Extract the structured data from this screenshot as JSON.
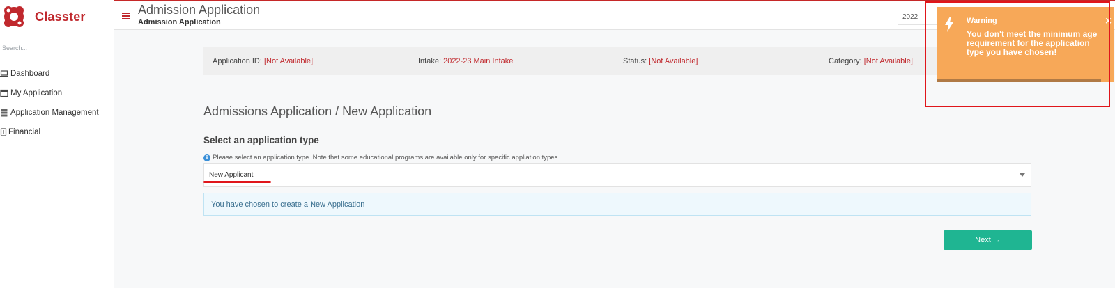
{
  "app": {
    "brand": "Classter"
  },
  "sidebar": {
    "search_placeholder": "Search...",
    "items": [
      {
        "label": "Dashboard",
        "icon": "laptop-icon"
      },
      {
        "label": "My Application",
        "icon": "window-icon"
      },
      {
        "label": "Application Management",
        "icon": "server-icon"
      },
      {
        "label": "Financial",
        "icon": "money-icon"
      }
    ]
  },
  "header": {
    "title": "Admission Application",
    "subtitle": "Admission Application",
    "year_value": "2022"
  },
  "infobar": {
    "application_id": {
      "label": "Application ID: ",
      "value": "[Not Available]"
    },
    "intake": {
      "label": "Intake: ",
      "value": "2022-23 Main Intake"
    },
    "status": {
      "label": "Status: ",
      "value": "[Not Available]"
    },
    "category": {
      "label": "Category: ",
      "value": "[Not Available]"
    }
  },
  "main": {
    "heading": "Admissions Application / New Application",
    "section_title": "Select an application type",
    "hint": "Please select an application type. Note that some educational programs are available only for specific appliation types.",
    "selected_type": "New Applicant",
    "info_message": "You have chosen to create a New Application",
    "next_label": "Next →"
  },
  "toast": {
    "title": "Warning",
    "message": "You don't meet the minimum age requirement for the application type you have chosen!",
    "close": "×",
    "progress": 0.93
  },
  "colors": {
    "brand_red": "#c0282d",
    "accent_green": "#1fb592",
    "warning_orange": "#f7a858",
    "annotation_red": "#e0161b"
  }
}
